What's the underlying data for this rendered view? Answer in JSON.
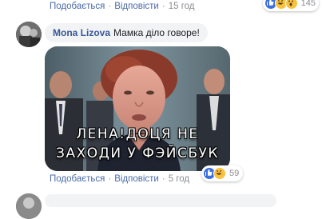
{
  "top_actions": {
    "like": "Подобається",
    "reply": "Відповісти",
    "time": "15 год"
  },
  "top_reactions": {
    "count": "145",
    "icons": [
      "like-icon",
      "haha-icon",
      "wow-icon"
    ]
  },
  "comment": {
    "author": "Mona Lizova",
    "text": "Мамка діло говоре!"
  },
  "meme": {
    "line1": "ЛЕНА!ДОЦЯ НЕ",
    "line2": "ЗАХОДИ У ФЭЙСБУК"
  },
  "meme_reactions": {
    "count": "59",
    "icons": [
      "like-icon",
      "haha-icon"
    ]
  },
  "comment_actions": {
    "like": "Подобається",
    "reply": "Відповісти",
    "time": "5 год"
  },
  "colors": {
    "link": "#4a6aa8",
    "author": "#385898",
    "muted": "#8b8d91",
    "bubble": "#f2f3f5",
    "like": "#3b6fe0",
    "haha": "#f7c23e"
  }
}
